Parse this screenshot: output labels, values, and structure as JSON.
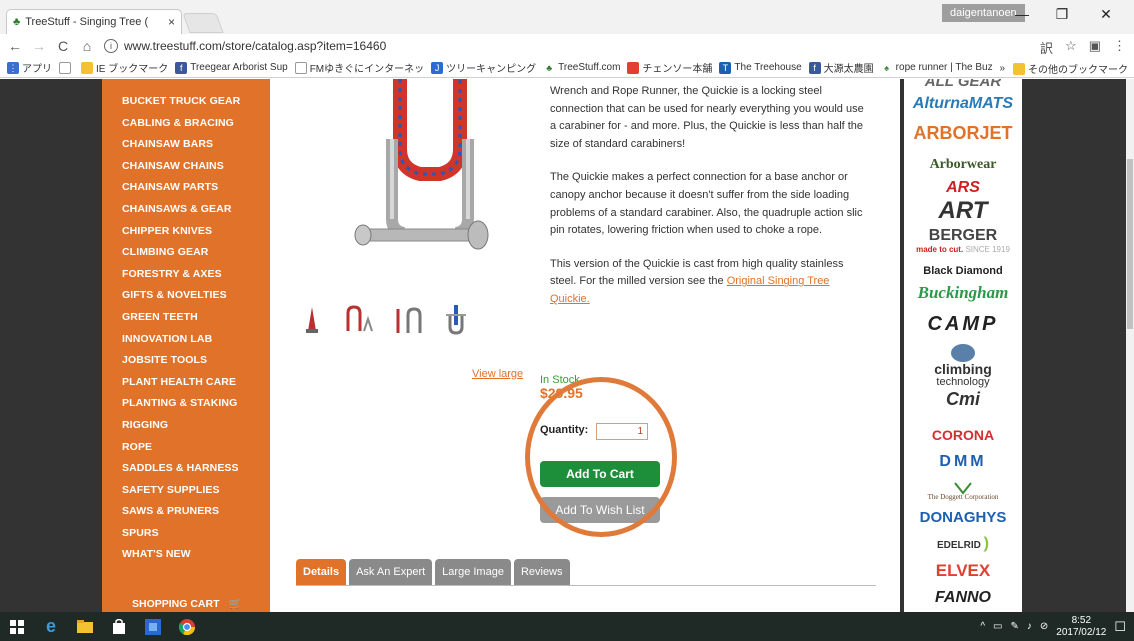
{
  "browser": {
    "tab_title": "TreeStuff - Singing Tree (",
    "tab_close": "×",
    "user": "daigentanoen",
    "url": "www.treestuff.com/store/catalog.asp?item=16460",
    "minimize": "—",
    "maximize": "❐",
    "close": "✕"
  },
  "bookmarks": {
    "apps": "アプリ",
    "items": [
      "IE ブックマーク",
      "Treegear Arborist Sup",
      "FMゆきぐにインターネッ",
      "ツリーキャンピング",
      "TreeStuff.com",
      "チェンソー本舗",
      "The Treehouse",
      "大源太農園",
      "rope runner | The Buz"
    ],
    "overflow": "»",
    "other": "その他のブックマーク"
  },
  "sidebar": {
    "items": [
      "BUCKET TRUCK GEAR",
      "CABLING & BRACING",
      "CHAINSAW BARS",
      "CHAINSAW CHAINS",
      "CHAINSAW PARTS",
      "CHAINSAWS & GEAR",
      "CHIPPER KNIVES",
      "CLIMBING GEAR",
      "FORESTRY & AXES",
      "GIFTS & NOVELTIES",
      "GREEN TEETH",
      "INNOVATION LAB",
      "JOBSITE TOOLS",
      "PLANT HEALTH CARE",
      "PLANTING & STAKING",
      "RIGGING",
      "ROPE",
      "SADDLES & HARNESS",
      "SAFETY SUPPLIES",
      "SAWS & PRUNERS",
      "SPURS",
      "WHAT'S NEW"
    ],
    "cart": "SHOPPING CART"
  },
  "product": {
    "desc1": "Wrench and Rope Runner, the Quickie is a locking steel connection that can be used for nearly everything you would use a carabiner for - and more. Plus, the Quickie is less than half the size of standard carabiners!",
    "desc2": "The Quickie makes a perfect connection for a base anchor or canopy anchor because it doesn't suffer from the side loading problems of a standard carabiner. Also, the quadruple action slic pin rotates, lowering friction when used to choke a rope.",
    "desc3_pre": "This version of the Quickie is cast from high quality stainless steel. For the milled version see the ",
    "desc3_link": "Original Singing Tree Quickie.",
    "view_large": "View large",
    "stock": "In Stock",
    "price": "$29.95",
    "qty_label": "Quantity:",
    "qty_value": "1",
    "add_to_cart": "Add To Cart",
    "add_to_wishlist": "Add To Wish List"
  },
  "tabs": [
    "Details",
    "Ask An Expert",
    "Large Image",
    "Reviews"
  ],
  "brands": [
    "ALL GEAR",
    "AlturnaMATS",
    "ARBORJET",
    "Arborwear",
    "ARS",
    "ART",
    "BERGER",
    "made to cut.",
    "SINCE 1919",
    "Black Diamond",
    "Buckingham",
    "CAMP",
    "climbing",
    "technology",
    "Cmi",
    "CORONA",
    "DMM",
    "The Doggett Corporation",
    "DONAGHYS",
    "EDELRID",
    "ELVEX",
    "FANNO"
  ],
  "taskbar": {
    "time": "8:52",
    "date": "2017/02/12"
  },
  "colors": {
    "accent_orange": "#e0722a",
    "cart_green": "#1d8f3a",
    "stock_green": "#3a9a3a"
  }
}
